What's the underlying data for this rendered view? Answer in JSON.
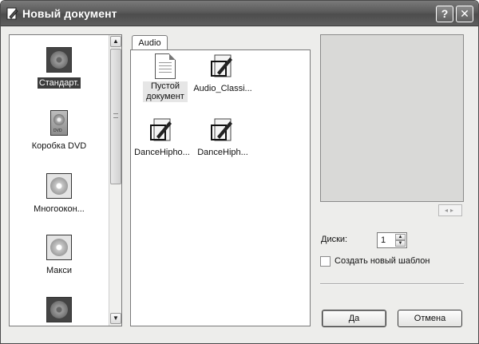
{
  "window": {
    "title": "Новый документ",
    "help_label": "?",
    "close_label": "✕"
  },
  "left_list": {
    "items": [
      {
        "label": "Стандарт.",
        "icon": "dark-disc-icon",
        "selected": true
      },
      {
        "label": "Коробка DVD",
        "icon": "dvd-box-icon",
        "selected": false
      },
      {
        "label": "Многоокон...",
        "icon": "disc-icon",
        "selected": false
      },
      {
        "label": "Макси",
        "icon": "disc-icon",
        "selected": false
      },
      {
        "label": "",
        "icon": "dark-disc-icon",
        "selected": false
      }
    ],
    "scroll_up": "▲",
    "scroll_down": "▼"
  },
  "templates": {
    "tab_label": "Audio",
    "items": [
      {
        "label": "Пустой документ",
        "icon": "blank-document-icon",
        "selected": true
      },
      {
        "label": "Audio_Classi...",
        "icon": "template-document-icon",
        "selected": false
      },
      {
        "label": "DanceHipho...",
        "icon": "template-document-icon",
        "selected": false
      },
      {
        "label": "DanceHiph...",
        "icon": "template-document-icon",
        "selected": false
      }
    ]
  },
  "options": {
    "discs_label": "Диски:",
    "discs_value": "1",
    "create_template_label": "Создать новый шаблон",
    "create_template_checked": false
  },
  "buttons": {
    "ok_label": "Да",
    "cancel_label": "Отмена"
  }
}
